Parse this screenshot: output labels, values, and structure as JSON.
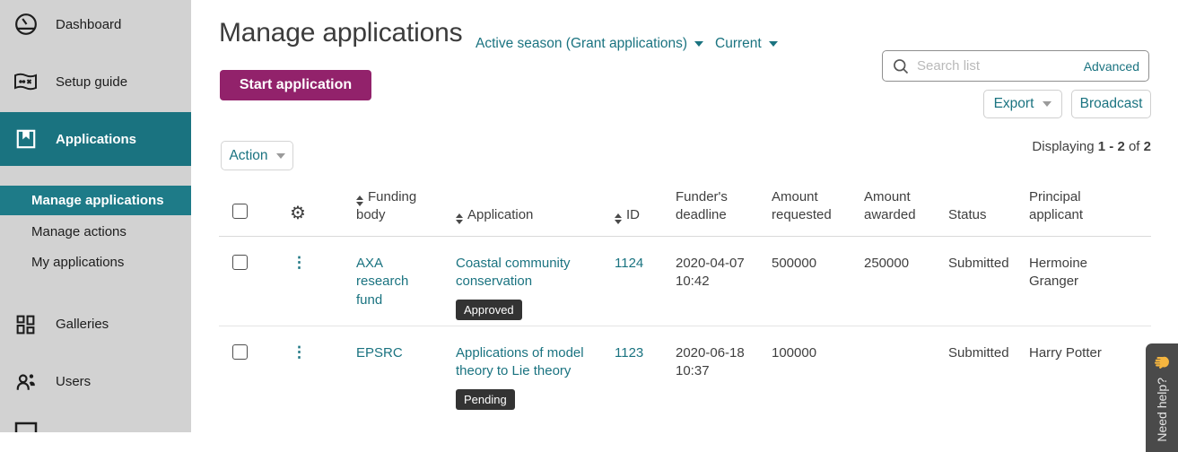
{
  "colors": {
    "accent_teal": "#1a7380",
    "accent_magenta": "#92226b",
    "sidebar_bg": "#d2d2d2",
    "badge_bg": "#333333",
    "help_tab_bg": "#4a4a4a"
  },
  "sidebar": {
    "dashboard": "Dashboard",
    "setup_guide": "Setup guide",
    "applications": "Applications",
    "manage_applications": "Manage applications",
    "manage_actions": "Manage actions",
    "my_applications": "My applications",
    "galleries": "Galleries",
    "users": "Users"
  },
  "header": {
    "title": "Manage applications",
    "season_selector": "Active season (Grant applications)",
    "view_selector": "Current",
    "start_button": "Start application",
    "search_placeholder": "Search list",
    "advanced_link": "Advanced",
    "export_button": "Export",
    "broadcast_button": "Broadcast"
  },
  "toolbar": {
    "action_button": "Action",
    "displaying_prefix": "Displaying",
    "displaying_range": "1 - 2",
    "displaying_of": "of",
    "displaying_total": "2"
  },
  "table": {
    "columns": [
      "Funding body",
      "Application",
      "ID",
      "Funder's deadline",
      "Amount requested",
      "Amount awarded",
      "Status",
      "Principal applicant"
    ],
    "rows": [
      {
        "funding_body": "AXA research fund",
        "application": "Coastal community conservation",
        "badge": "Approved",
        "id": "1124",
        "deadline": "2020-04-07 10:42",
        "amount_requested": "500000",
        "amount_awarded": "250000",
        "status": "Submitted",
        "principal_applicant": "Hermoine Granger"
      },
      {
        "funding_body": "EPSRC",
        "application": "Applications of model theory to Lie theory",
        "badge": "Pending",
        "id": "1123",
        "deadline": "2020-06-18 10:37",
        "amount_requested": "100000",
        "amount_awarded": "",
        "status": "Submitted",
        "principal_applicant": "Harry Potter"
      }
    ]
  },
  "help_tab": {
    "label": "Need help?"
  }
}
